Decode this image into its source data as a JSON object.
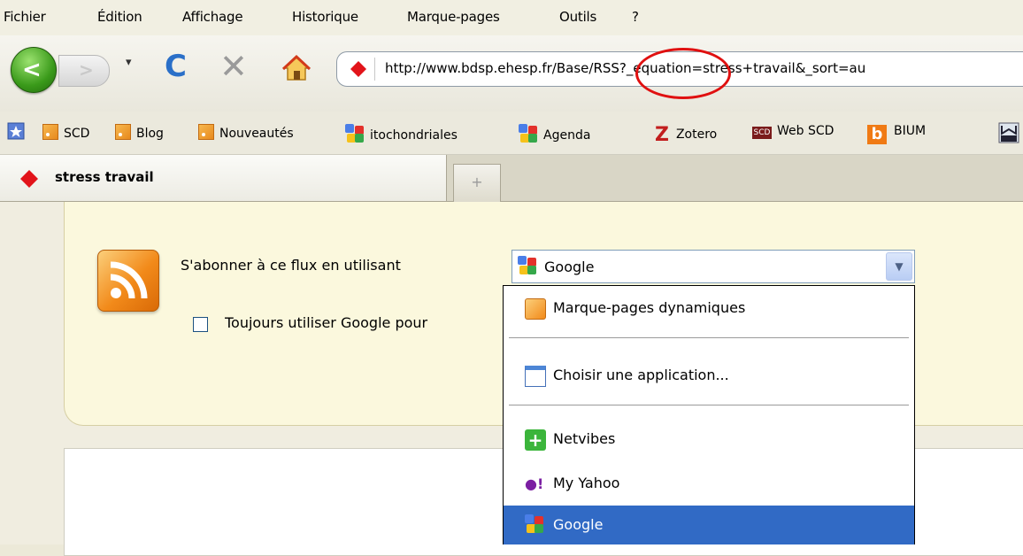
{
  "menu": {
    "items": [
      {
        "label": "Fichier"
      },
      {
        "label": "Édition"
      },
      {
        "label": "Affichage"
      },
      {
        "label": "Historique"
      },
      {
        "label": "Marque-pages"
      },
      {
        "label": "Outils"
      },
      {
        "label": "?"
      }
    ]
  },
  "navigation": {
    "url": "http://www.bdsp.ehesp.fr/Base/RSS?_equation=stress+travail&_sort=au"
  },
  "bookmarks": {
    "items": [
      {
        "label": "SCD"
      },
      {
        "label": "Blog"
      },
      {
        "label": "Nouveautés"
      },
      {
        "label": "itochondriales"
      },
      {
        "label": "Agenda"
      },
      {
        "label": "Zotero"
      },
      {
        "label": "Web SCD"
      },
      {
        "label": "BIUM"
      }
    ]
  },
  "tabs": {
    "active_title": "stress travail",
    "new_tab_symbol": "+"
  },
  "feed": {
    "subscribe_label": "S'abonner à ce flux en utilisant",
    "selected_reader": "Google",
    "always_use_label": "Toujours utiliser Google pour",
    "dropdown_options": [
      {
        "label": "Marque-pages dynamiques"
      },
      {
        "label": "Choisir une application..."
      },
      {
        "label": "Netvibes"
      },
      {
        "label": "My Yahoo"
      },
      {
        "label": "Google"
      }
    ],
    "highlighted_option": "Google"
  },
  "annotation": {
    "color": "#e01010"
  }
}
